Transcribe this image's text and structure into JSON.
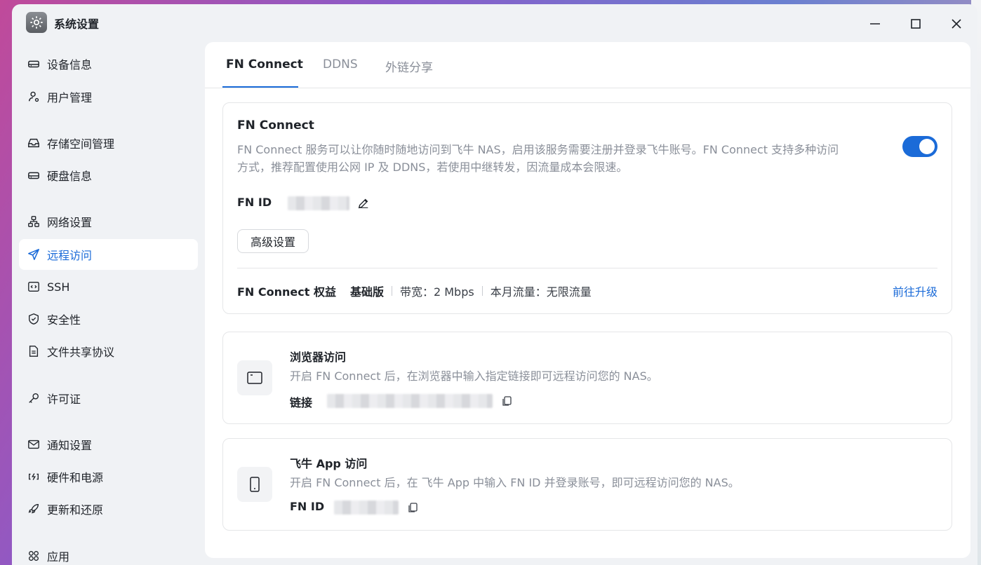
{
  "window": {
    "title": "系统设置"
  },
  "sidebar": {
    "items": [
      {
        "label": "设备信息",
        "icon": "device-icon"
      },
      {
        "label": "用户管理",
        "icon": "user-settings-icon"
      },
      {
        "label": "存储空间管理",
        "icon": "storage-icon"
      },
      {
        "label": "硬盘信息",
        "icon": "disk-icon"
      },
      {
        "label": "网络设置",
        "icon": "network-icon"
      },
      {
        "label": "远程访问",
        "icon": "send-icon",
        "active": true
      },
      {
        "label": "SSH",
        "icon": "code-icon"
      },
      {
        "label": "安全性",
        "icon": "shield-icon"
      },
      {
        "label": "文件共享协议",
        "icon": "file-icon"
      },
      {
        "label": "许可证",
        "icon": "key-icon"
      },
      {
        "label": "通知设置",
        "icon": "mail-icon"
      },
      {
        "label": "硬件和电源",
        "icon": "power-icon"
      },
      {
        "label": "更新和还原",
        "icon": "rocket-icon"
      },
      {
        "label": "应用",
        "icon": "apps-icon"
      }
    ]
  },
  "tabs": [
    {
      "label": "FN Connect",
      "active": true
    },
    {
      "label": "DDNS"
    },
    {
      "label": "外链分享"
    }
  ],
  "fn_connect": {
    "title": "FN Connect",
    "description_line1": "FN Connect 服务可以让你随时随地访问到飞牛 NAS，启用该服务需要注册并登录飞牛账号。FN Connect 支持多种访问",
    "description_line2": "方式，推荐配置使用公网 IP 及 DDNS，若使用中继转发，因流量成本会限速。",
    "enabled": true,
    "fn_id_label": "FN ID",
    "advanced_button": "高级设置",
    "perks_label": "FN Connect 权益",
    "plan": "基础版",
    "bandwidth": "带宽：2 Mbps",
    "traffic": "本月流量：无限流量",
    "upgrade_link": "前往升级"
  },
  "browser_access": {
    "title": "浏览器访问",
    "description": "开启 FN Connect 后，在浏览器中输入指定链接即可远程访问您的 NAS。",
    "link_label": "链接"
  },
  "app_access": {
    "title": "飞牛 App 访问",
    "description": "开启 FN Connect 后，在 飞牛 App 中输入 FN ID 并登录账号，即可远程访问您的 NAS。",
    "fn_id_label": "FN ID"
  },
  "colors": {
    "accent": "#1b6bd8",
    "muted": "#8a8f99",
    "text": "#1f2329"
  }
}
